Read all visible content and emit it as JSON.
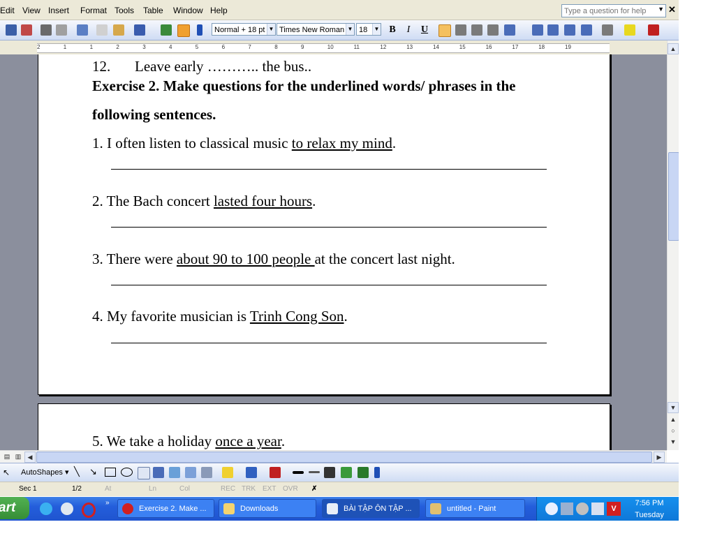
{
  "menu": {
    "items": [
      "Edit",
      "View",
      "Insert",
      "Format",
      "Tools",
      "Table",
      "Window",
      "Help"
    ],
    "help_placeholder": "Type a question for help"
  },
  "toolbar": {
    "style": "Normal + 18 pt",
    "font": "Times New Roman",
    "size": "18",
    "bold": "B",
    "italic": "I",
    "underline": "U"
  },
  "ruler": {
    "ticks": [
      "2",
      "1",
      "1",
      "2",
      "3",
      "4",
      "5",
      "6",
      "7",
      "8",
      "9",
      "10",
      "11",
      "12",
      "13",
      "14",
      "15",
      "16",
      "17",
      "18",
      "19"
    ]
  },
  "document": {
    "line12_num": "12.",
    "line12_text": "Leave early ……….. the bus..",
    "heading_line1": "Exercise 2. Make questions for the underlined words/ phrases in the",
    "heading_line2": "following sentences.",
    "questions": [
      {
        "pre": "1. I often listen to classical music ",
        "u": "to relax my mind",
        "post": "."
      },
      {
        "pre": "2. The Bach concert ",
        "u": "lasted four hours",
        "post": "."
      },
      {
        "pre": "3. There were ",
        "u": "about 90 to 100 people ",
        "post": "at the concert last night."
      },
      {
        "pre": "4. My favorite musician is ",
        "u": "Trinh Cong Son",
        "post": "."
      },
      {
        "pre": "5. We take a holiday ",
        "u": "once a year",
        "post": "."
      }
    ]
  },
  "drawbar": {
    "autoshapes": "AutoShapes"
  },
  "status": {
    "sec": "Sec 1",
    "page": "1/2",
    "at": "At",
    "ln": "Ln",
    "col": "Col",
    "rec": "REC",
    "trk": "TRK",
    "ext": "EXT",
    "ovr": "OVR"
  },
  "taskbar": {
    "start": "art",
    "tasks": [
      "Exercise 2. Make ...",
      "Downloads",
      "BÀI TẬP ÔN TẬP ...",
      "untitled - Paint"
    ],
    "time": "7:56 PM",
    "day": "Tuesday"
  },
  "colors": {
    "accent": "#245edb",
    "doc_bg": "#8b8f9d"
  }
}
